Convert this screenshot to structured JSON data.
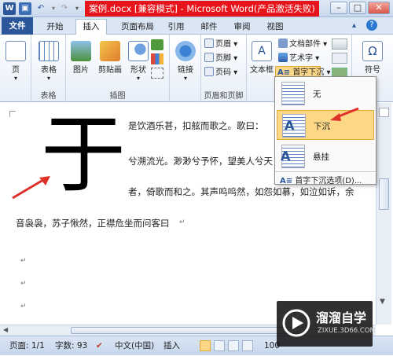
{
  "window": {
    "title": "案例.docx [兼容模式] - Microsoft Word(产品激活失败)",
    "controls": {
      "minimize": "–",
      "maximize": "□",
      "close": "✕",
      "help": "?"
    }
  },
  "tabs": [
    "文件",
    "开始",
    "插入",
    "页面布局",
    "引用",
    "邮件",
    "审阅",
    "视图"
  ],
  "active_tab": "插入",
  "ribbon": {
    "pages": {
      "page": "页",
      "label": ""
    },
    "tables": {
      "table": "表格",
      "label": "表格"
    },
    "illustrations": {
      "picture": "图片",
      "clipart": "剪贴画",
      "shapes": "形状",
      "label": "插图"
    },
    "links": {
      "link": "链接",
      "label": ""
    },
    "header_footer": {
      "header": "页眉",
      "footer": "页脚",
      "page_number": "页码",
      "label": "页眉和页脚"
    },
    "text": {
      "textbox": "文本框",
      "docparts": "文档部件",
      "wordart": "艺术字",
      "dropcap": "首字下沉"
    },
    "symbols": {
      "equation": "Ω",
      "symbol": "符号"
    }
  },
  "dropcap_menu": {
    "items": [
      {
        "label": "无"
      },
      {
        "label": "下沉"
      },
      {
        "label": "悬挂"
      }
    ],
    "options": "首字下沉选项(D)..."
  },
  "document": {
    "dropcap_char": "于",
    "lines": [
      "是饮酒乐甚，扣舷而歌之。歌曰：",
      "兮溯流光。渺渺兮予怀，望美人兮天",
      "者，倚歌而和之。其声呜呜然，如怨如慕，如泣如诉，余",
      "音袅袅，苏子愀然，正襟危坐而问客曰"
    ],
    "para_mark": "↵"
  },
  "status": {
    "page": "页面: 1/1",
    "words": "字数: 93",
    "lang": "中文(中国)",
    "mode": "插入",
    "zoom": "100"
  },
  "watermark": {
    "brand": "溜溜自学",
    "url": "ZIXUE.3D66.COM"
  },
  "colors": {
    "accent": "#2b579a",
    "title_highlight": "#e8141b",
    "arrow": "#e0302a",
    "hover": "#fbd786"
  }
}
